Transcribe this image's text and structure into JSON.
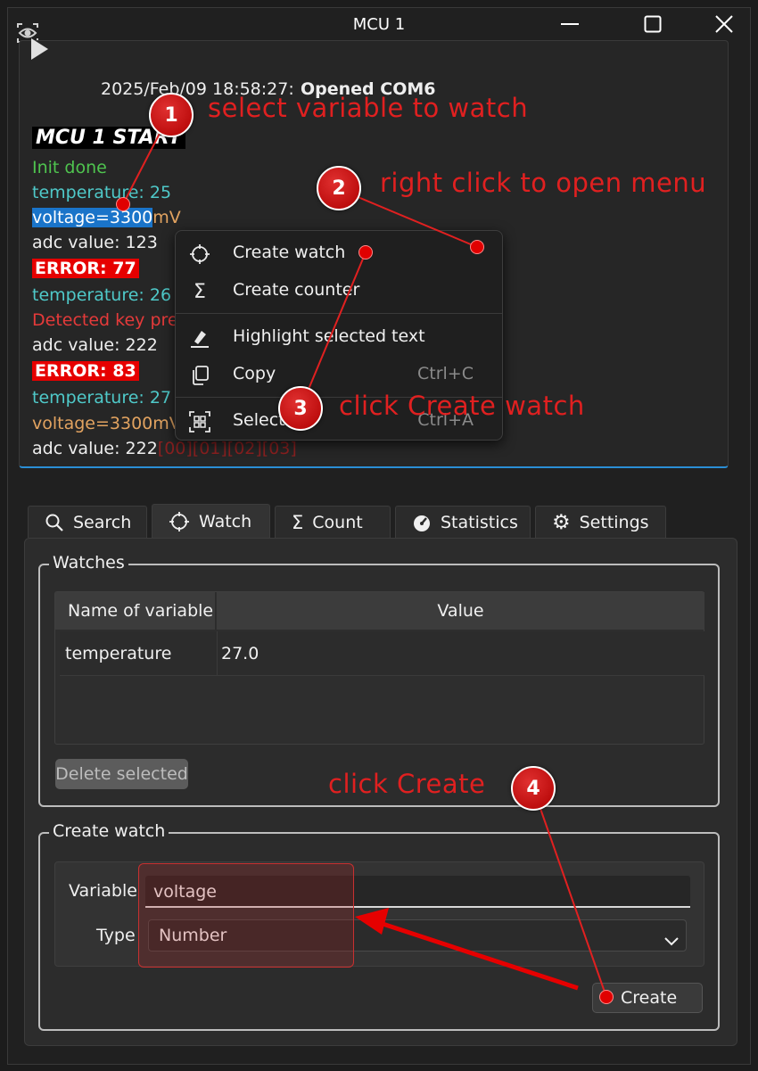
{
  "window": {
    "title": "MCU 1"
  },
  "log": {
    "header_timestamp": "2025/Feb/09 18:58:27:",
    "header_message": "Opened COM6",
    "mcu_start": "MCU 1 START",
    "init_done": "Init done",
    "temp1": "temperature: 25",
    "voltage_sel": "voltage=3300",
    "voltage_unit": "mV",
    "adc1": "adc value: 123",
    "error1": "ERROR: 77",
    "temp2": "temperature: 26",
    "detected": "Detected key pre",
    "adc2": "adc value: 222",
    "error2": "ERROR: 83",
    "temp3": "temperature: 27",
    "voltage2": "voltage=3300mV",
    "adc3": "adc value: 222",
    "hex_bytes": "[00][01][02][03]"
  },
  "context_menu": {
    "items": [
      {
        "label": "Create watch",
        "icon": "crosshair-icon",
        "shortcut": ""
      },
      {
        "label": "Create counter",
        "icon": "sigma-icon",
        "shortcut": ""
      },
      {
        "label": "Highlight selected text",
        "icon": "highlighter-icon",
        "shortcut": ""
      },
      {
        "label": "Copy",
        "icon": "copy-icon",
        "shortcut": "Ctrl+C"
      },
      {
        "label": "Select All",
        "icon": "select-all-icon",
        "shortcut": "Ctrl+A"
      }
    ]
  },
  "tabs": [
    {
      "label": "Search",
      "icon": "search-icon"
    },
    {
      "label": "Watch",
      "icon": "crosshair-icon"
    },
    {
      "label": "Count",
      "icon": "sigma-icon"
    },
    {
      "label": "Statistics",
      "icon": "gauge-icon"
    },
    {
      "label": "Settings",
      "icon": "gear-icon"
    }
  ],
  "watches": {
    "title": "Watches",
    "columns": [
      "Name of variable",
      "Value"
    ],
    "rows": [
      {
        "name": "temperature",
        "value": "27.0"
      }
    ],
    "delete_label": "Delete selected"
  },
  "create_watch": {
    "title": "Create watch",
    "variable_label": "Variable",
    "variable_value": "voltage",
    "type_label": "Type",
    "type_value": "Number",
    "create_label": "Create"
  },
  "annotations": [
    {
      "number": "1",
      "text": "select variable to watch"
    },
    {
      "number": "2",
      "text": "right click to open menu"
    },
    {
      "number": "3",
      "text": "click Create watch"
    },
    {
      "number": "4",
      "text": "click Create"
    }
  ],
  "colors": {
    "accent": "#2a8ed6",
    "selection": "#1a74c9",
    "error_bg": "#e60000",
    "annotation": "#e02020",
    "green_text": "#4fc44f",
    "cyan_text": "#4fc9c9",
    "orange_text": "#e2a360"
  }
}
